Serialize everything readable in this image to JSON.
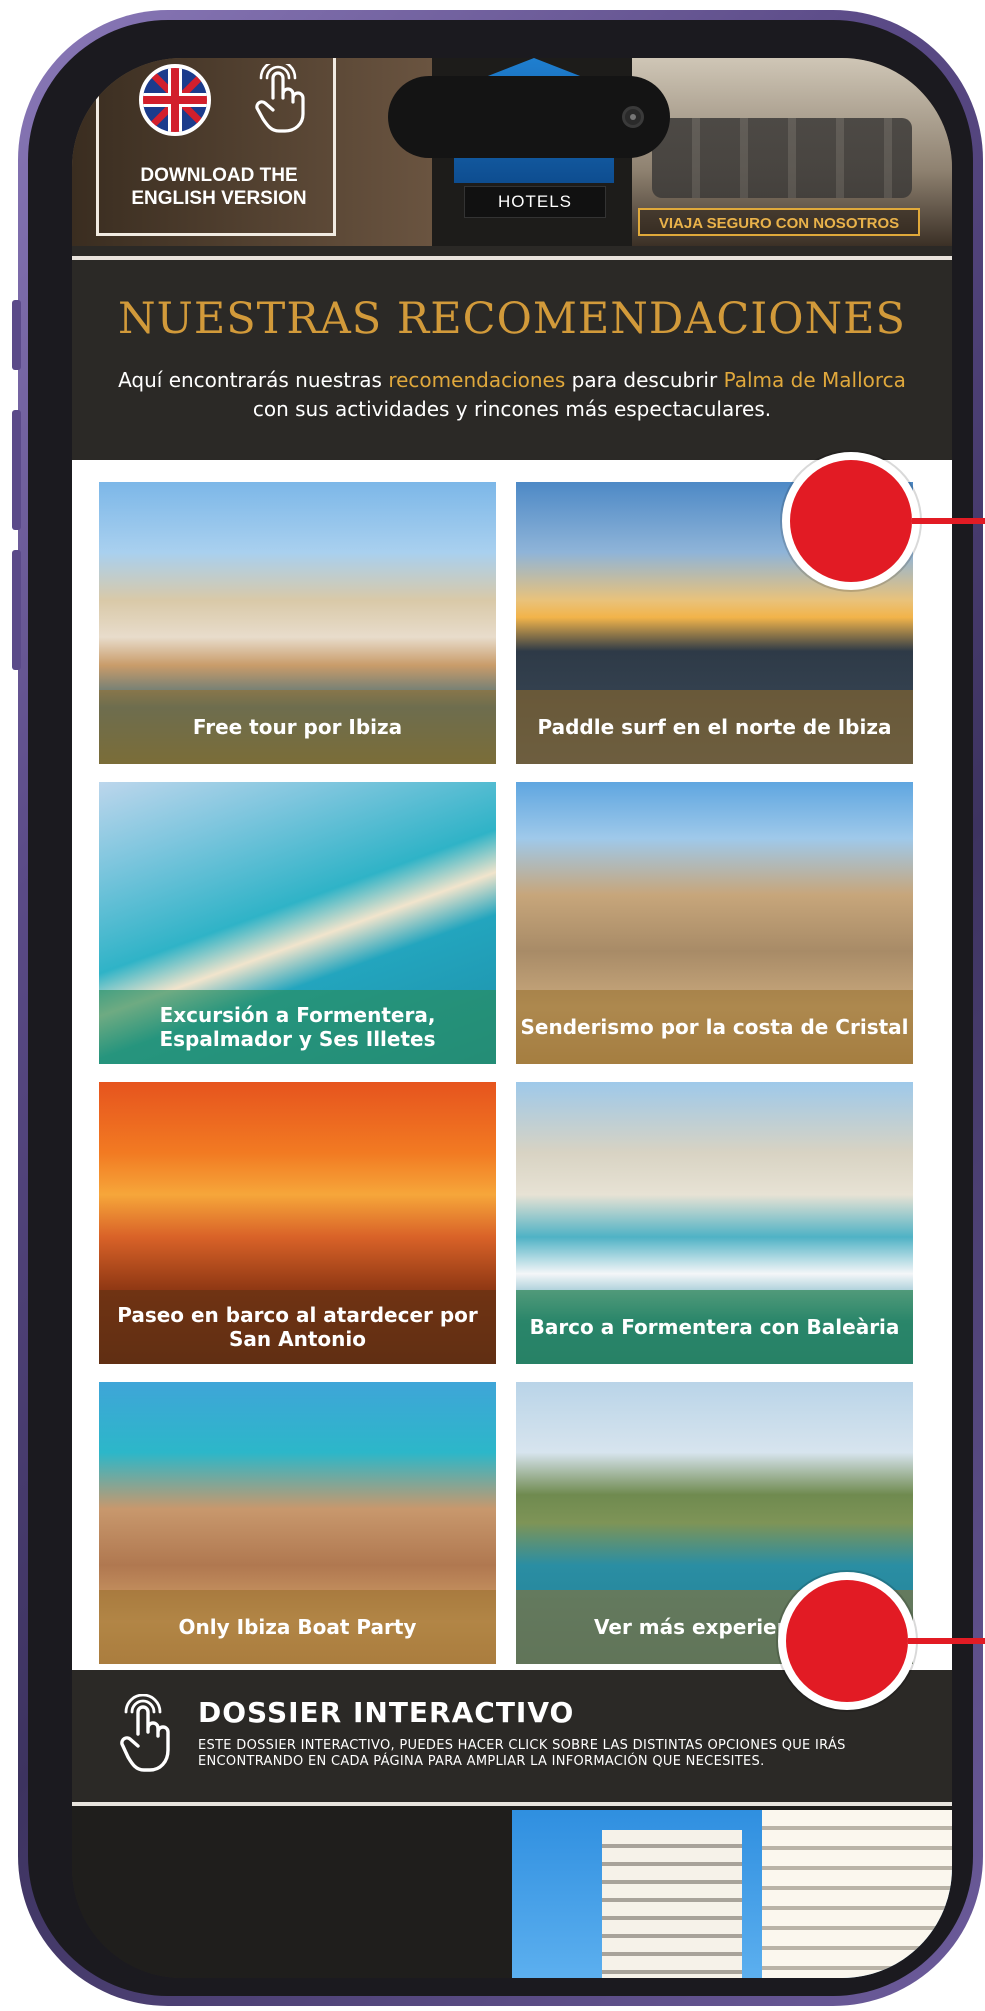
{
  "banner": {
    "english_label": "DOWNLOAD THE ENGLISH VERSION",
    "hotels_label": "HOTELS",
    "viaja_label": "VIAJA SEGURO CON NOSOTROS"
  },
  "recommendations": {
    "title": "NUESTRAS RECOMENDACIONES",
    "subtitle_part1": "Aquí encontrarás nuestras ",
    "subtitle_highlight1": "recomendaciones",
    "subtitle_part2": " para descubrir ",
    "subtitle_highlight2": "Palma de Mallorca",
    "subtitle_part3": "  con sus actividades y rincones más espectaculares."
  },
  "cards": [
    {
      "label": "Free tour por Ibiza"
    },
    {
      "label": "Paddle surf en el norte de Ibiza"
    },
    {
      "label": "Excursión a Formentera, Espalmador y Ses Illetes"
    },
    {
      "label": "Senderismo por la costa de Cristal"
    },
    {
      "label": "Paseo en barco al atardecer por San Antonio"
    },
    {
      "label": "Barco a Formentera con Baleària"
    },
    {
      "label": "Only Ibiza Boat Party"
    },
    {
      "label": "Ver más experiencias"
    }
  ],
  "dossier": {
    "title": "DOSSIER INTERACTIVO",
    "text": "ESTE DOSSIER INTERACTIVO, PUEDES HACER CLICK SOBRE LAS DISTINTAS OPCIONES QUE IRÁS ENCONTRANDO EN CADA PÁGINA PARA AMPLIAR LA INFORMACIÓN QUE NECESITES."
  },
  "colors": {
    "gold": "#d29a3a",
    "dark_bg": "#2b2926",
    "marker_red": "#e21b24",
    "phone_frame": "#5a4a86"
  },
  "icons": [
    "uk-flag-icon",
    "hand-pointer-icon"
  ]
}
